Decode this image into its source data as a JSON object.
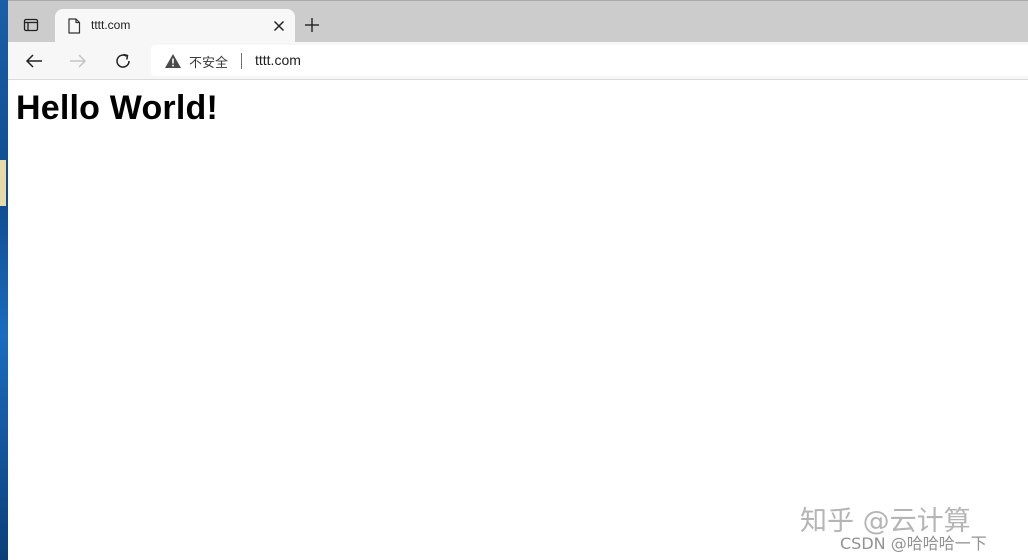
{
  "browser": {
    "tab": {
      "title": "tttt.com",
      "favicon": "page-icon",
      "close_icon": "close-icon"
    },
    "tab_actions_icon": "tab-actions-icon",
    "new_tab_icon": "plus-icon",
    "toolbar": {
      "back_icon": "back-arrow-icon",
      "forward_icon": "forward-arrow-icon",
      "refresh_icon": "refresh-icon"
    },
    "address_bar": {
      "security_icon": "warning-icon",
      "security_label": "不安全",
      "url": "tttt.com"
    }
  },
  "page": {
    "heading": "Hello World!"
  },
  "watermarks": {
    "zhihu": "知乎 @云计算",
    "csdn": "CSDN @哈哈哈一下"
  },
  "colors": {
    "tabstrip_bg": "#cccccc",
    "toolbar_bg": "#f7f7f7",
    "page_bg": "#ffffff",
    "heading_color": "#000000"
  }
}
